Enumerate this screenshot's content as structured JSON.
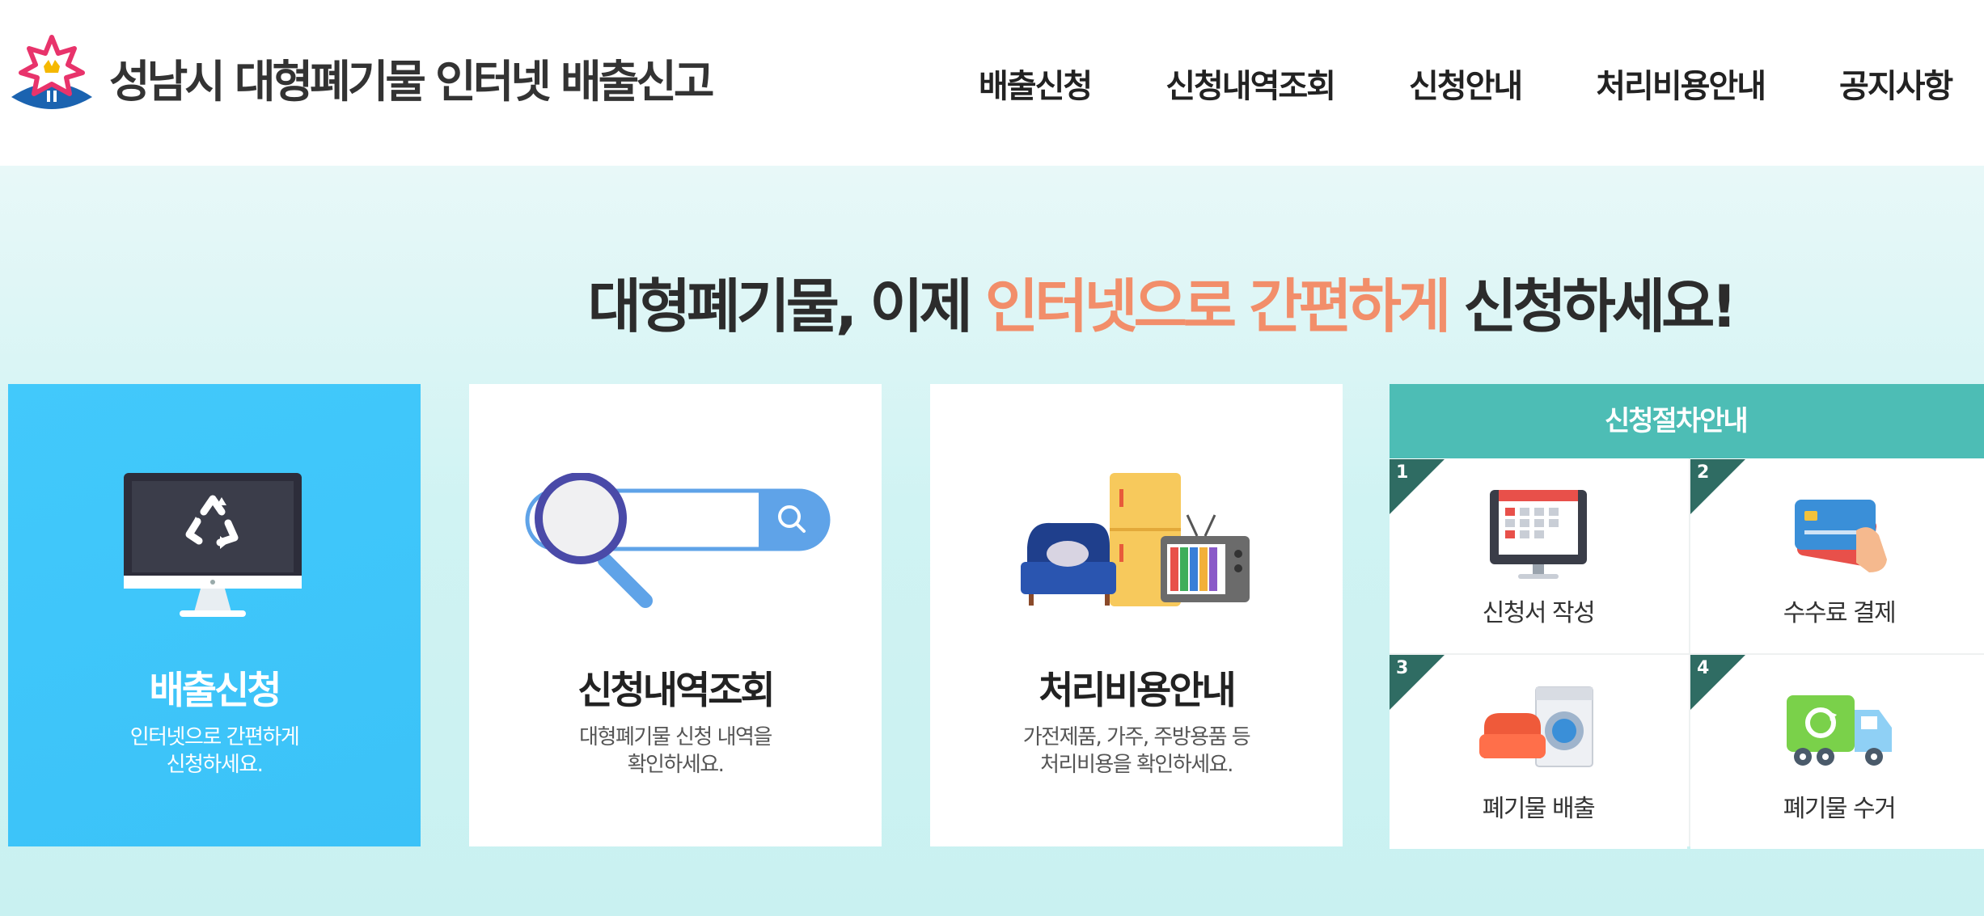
{
  "header": {
    "site_title": "성남시 대형폐기물 인터넷 배출신고",
    "nav": [
      "배출신청",
      "신청내역조회",
      "신청안내",
      "처리비용안내",
      "공지사항"
    ]
  },
  "hero": {
    "heading_pre": "대형폐기물, 이제 ",
    "heading_highlight": "인터넷으로 간편하게",
    "heading_post": " 신청하세요!"
  },
  "cards": [
    {
      "title": "배출신청",
      "desc_line1": "인터넷으로 간편하게",
      "desc_line2": "신청하세요.",
      "active": true
    },
    {
      "title": "신청내역조회",
      "desc_line1": "대형폐기물 신청 내역을",
      "desc_line2": "확인하세요."
    },
    {
      "title": "처리비용안내",
      "desc_line1": "가전제품, 가주, 주방용품 등",
      "desc_line2": "처리비용을 확인하세요."
    }
  ],
  "procedure": {
    "title": "신청절차안내",
    "steps": [
      {
        "num": "1",
        "label": "신청서 작성",
        "icon": "calendar-monitor-icon"
      },
      {
        "num": "2",
        "label": "수수료 결제",
        "icon": "credit-card-icon"
      },
      {
        "num": "3",
        "label": "폐기물 배출",
        "icon": "sofa-washer-icon"
      },
      {
        "num": "4",
        "label": "폐기물 수거",
        "icon": "recycle-truck-icon"
      }
    ]
  },
  "colors": {
    "accent_blue": "#3fc6fa",
    "highlight": "#f28e6a",
    "teal": "#4dbdb5",
    "dark_teal": "#2f6c63"
  }
}
